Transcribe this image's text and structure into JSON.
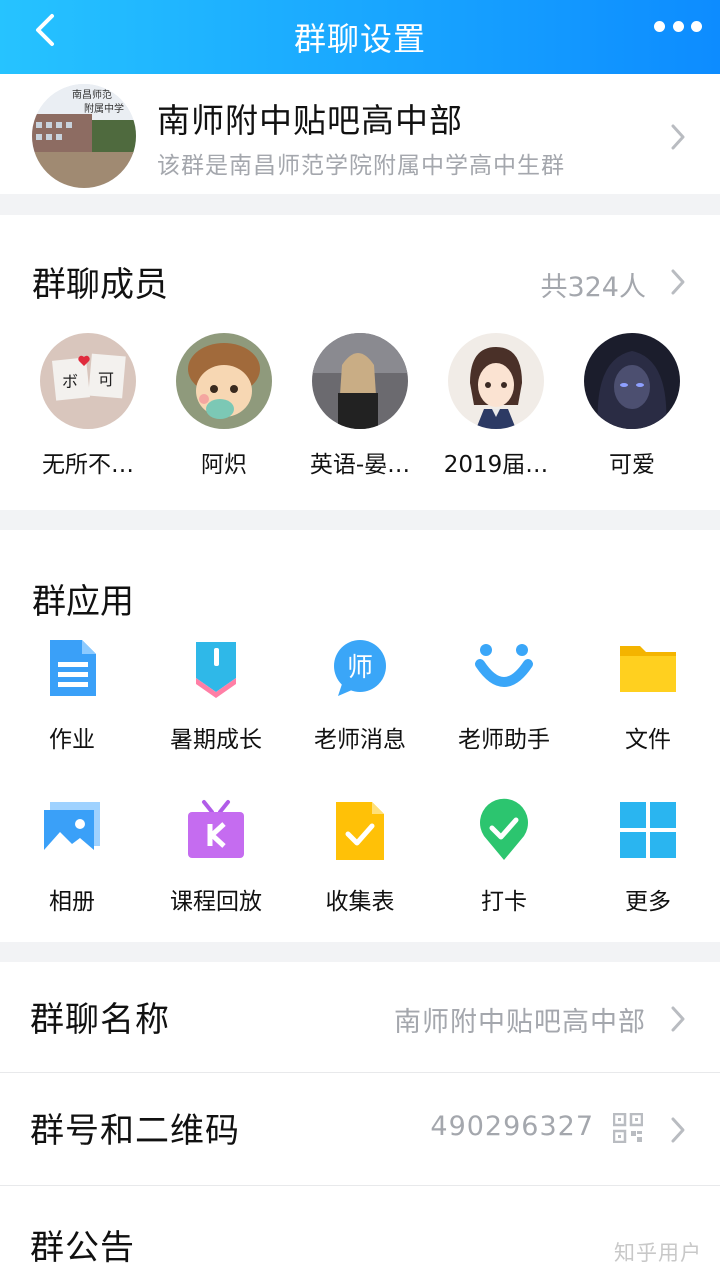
{
  "header": {
    "title": "群聊设置"
  },
  "group": {
    "name": "南师附中贴吧高中部",
    "description": "该群是南昌师范学院附属中学高中生群"
  },
  "members": {
    "title": "群聊成员",
    "count": "共324人",
    "items": [
      {
        "name": "无所不…"
      },
      {
        "name": "阿炽"
      },
      {
        "name": "英语-晏…"
      },
      {
        "name": "2019届…"
      },
      {
        "name": "可爱"
      }
    ]
  },
  "apps": {
    "title": "群应用",
    "items": [
      {
        "label": "作业",
        "icon": "homework-icon"
      },
      {
        "label": "暑期成长",
        "icon": "summer-growth-icon"
      },
      {
        "label": "老师消息",
        "icon": "teacher-message-icon"
      },
      {
        "label": "老师助手",
        "icon": "teacher-assistant-icon"
      },
      {
        "label": "文件",
        "icon": "folder-icon"
      },
      {
        "label": "相册",
        "icon": "album-icon"
      },
      {
        "label": "课程回放",
        "icon": "course-replay-icon"
      },
      {
        "label": "收集表",
        "icon": "form-icon"
      },
      {
        "label": "打卡",
        "icon": "checkin-icon"
      },
      {
        "label": "更多",
        "icon": "more-apps-icon"
      }
    ]
  },
  "settings": {
    "group_name_label": "群聊名称",
    "group_name_value": "南师附中贴吧高中部",
    "group_id_label": "群号和二维码",
    "group_id_value": "490296327",
    "notice_label": "群公告"
  },
  "watermark": "知乎用户",
  "colors": {
    "header_start": "#26c3ff",
    "header_end": "#0d8cff"
  }
}
